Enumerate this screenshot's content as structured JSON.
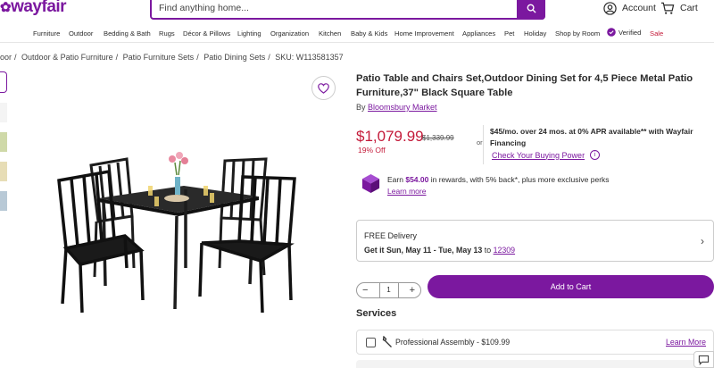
{
  "header": {
    "logo_text": "wayfair",
    "search_placeholder": "Find anything home...",
    "account_label": "Account",
    "cart_label": "Cart"
  },
  "catnav": {
    "items": [
      "Furniture",
      "Outdoor",
      "Bedding & Bath",
      "Rugs",
      "Décor & Pillows",
      "Lighting",
      "Organization",
      "Kitchen",
      "Baby & Kids",
      "Home Improvement",
      "Appliances",
      "Pet",
      "Holiday",
      "Shop by Room"
    ],
    "verified_label": "Verified",
    "sale_label": "Sale"
  },
  "breadcrumb": {
    "items": [
      "oor",
      "Outdoor & Patio Furniture",
      "Patio Furniture Sets",
      "Patio Dining Sets"
    ],
    "sku": "SKU: W113581357"
  },
  "product": {
    "title": "Patio Table and Chairs Set,Outdoor Dining Set for 4,5 Piece Metal Patio Furniture,37\" Black Square Table",
    "by_prefix": "By",
    "brand": "Bloomsbury Market",
    "price": "$1,079.99",
    "was_price": "$1,339.99",
    "discount": "19% Off",
    "or_label": "or",
    "financing_text": "$45/mo. over 24 mos. at 0% APR available** with Wayfair Financing",
    "financing_link": "Check Your Buying Power",
    "rewards_prefix": "Earn",
    "rewards_amount": "$54.00",
    "rewards_suffix": "in rewards, with 5% back*, plus more exclusive perks",
    "rewards_link": "Learn more"
  },
  "delivery": {
    "title": "FREE Delivery",
    "line_prefix": "Get it",
    "dates": "Sun, May 11 - Tue, May 13",
    "to_label": "to",
    "zip": "12309"
  },
  "cart": {
    "quantity": "1",
    "minus": "−",
    "plus": "+",
    "add_label": "Add to Cart"
  },
  "services": {
    "heading": "Services",
    "assembly_label": "Professional Assembly - $109.99",
    "learn_more": "Learn More"
  },
  "colors": {
    "brand": "#7b189f",
    "sale": "#c41b3a"
  }
}
